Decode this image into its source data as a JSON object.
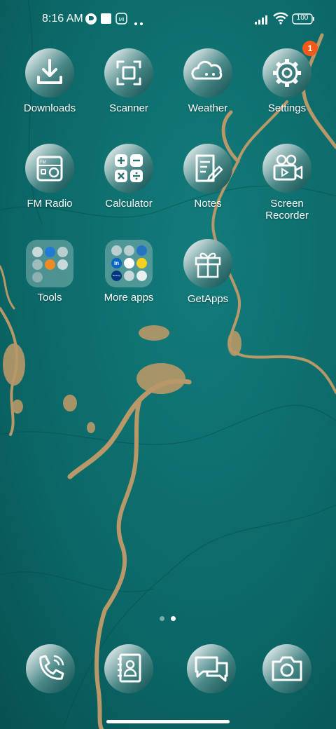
{
  "status_bar": {
    "time": "8:16 AM",
    "battery": "100"
  },
  "home": {
    "apps": [
      {
        "label": "Downloads",
        "icon": "download-icon"
      },
      {
        "label": "Scanner",
        "icon": "scanner-icon"
      },
      {
        "label": "Weather",
        "icon": "weather-icon"
      },
      {
        "label": "Settings",
        "icon": "gear-icon",
        "badge": "1"
      },
      {
        "label": "FM Radio",
        "icon": "radio-icon"
      },
      {
        "label": "Calculator",
        "icon": "calculator-icon"
      },
      {
        "label": "Notes",
        "icon": "notes-icon"
      },
      {
        "label": "Screen\nRecorder",
        "icon": "screen-recorder-icon"
      },
      {
        "label": "Tools",
        "icon": "folder-icon"
      },
      {
        "label": "More apps",
        "icon": "folder-icon"
      },
      {
        "label": "GetApps",
        "icon": "gift-icon"
      }
    ],
    "folder_mini_text": {
      "linkedin": "in",
      "booking": "Booking"
    }
  },
  "dock": [
    {
      "icon": "phone-icon"
    },
    {
      "icon": "contacts-icon"
    },
    {
      "icon": "messages-icon"
    },
    {
      "icon": "camera-icon"
    }
  ],
  "colors": {
    "wallpaper": "#0e6b6b",
    "marble_vein": "#b89868",
    "badge": "#f25a1b"
  },
  "page_indicator": {
    "pages": 2,
    "current": 2
  }
}
